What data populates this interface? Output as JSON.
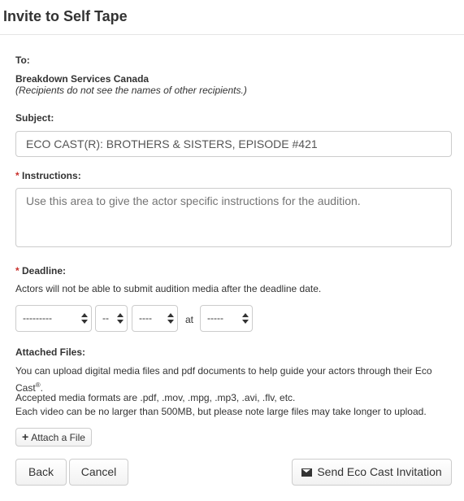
{
  "modal": {
    "title": "Invite to Self Tape"
  },
  "to": {
    "label": "To:",
    "recipient": "Breakdown Services Canada",
    "note": "(Recipients do not see the names of other recipients.)"
  },
  "subject": {
    "label": "Subject:",
    "value": "ECO CAST(R): BROTHERS & SISTERS, EPISODE #421"
  },
  "instructions": {
    "required_marker": "*",
    "label": "Instructions:",
    "placeholder": "Use this area to give the actor specific instructions for the audition."
  },
  "deadline": {
    "required_marker": "*",
    "label": "Deadline:",
    "help": "Actors will not be able to submit audition media after the deadline date.",
    "month": "---------",
    "day": "--",
    "year": "----",
    "at_label": "at",
    "time": "-----"
  },
  "attached": {
    "label": "Attached Files:",
    "line1": "You can upload digital media files and pdf documents to help guide your actors through their Eco",
    "line1b": "Cast",
    "registered": "®",
    "line1c": ".",
    "line2": "Accepted media formats are .pdf, .mov, .mpg, .mp3, .avi, .flv, etc.",
    "line3": "Each video can be no larger than 500MB, but please note large files may take longer to upload.",
    "attach_icon": "plus-icon",
    "attach_label": "Attach a File"
  },
  "footer": {
    "back_label": "Back",
    "cancel_label": "Cancel",
    "send_icon": "envelope-icon",
    "send_label": "Send Eco Cast Invitation"
  }
}
